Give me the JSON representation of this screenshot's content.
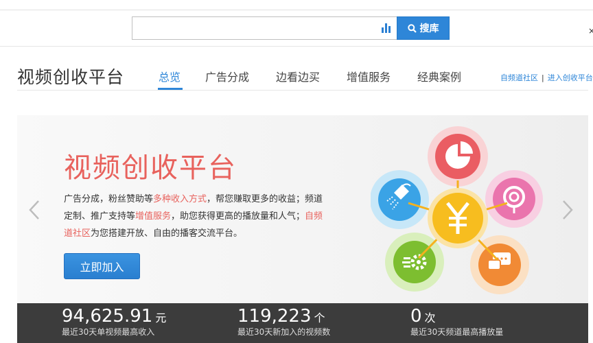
{
  "search": {
    "placeholder": "",
    "value": "",
    "button_label": "搜库"
  },
  "corner_mark": "×",
  "brand": {
    "title": "视频创收平台"
  },
  "nav": {
    "items": [
      {
        "label": "总览",
        "active": true
      },
      {
        "label": "广告分成",
        "active": false
      },
      {
        "label": "边看边买",
        "active": false
      },
      {
        "label": "增值服务",
        "active": false
      },
      {
        "label": "经典案例",
        "active": false
      }
    ],
    "links": [
      {
        "label": "自频道社区"
      },
      {
        "label": "进入创收平台"
      }
    ],
    "link_separator": "|"
  },
  "banner": {
    "title": "视频创收平台",
    "desc": {
      "p1": "广告分成，粉丝赞助等",
      "h1": "多种收入方式",
      "p2": "，帮您赚取更多的收益；频道定制、推广支持等",
      "h2": "增值服务",
      "p3": "，助您获得更高的播放量和人气；",
      "h3": "自频道社区",
      "p4": "为您搭建开放、自由的播客交流平台。"
    },
    "join_button": "立即加入",
    "icons": [
      "pie-chart-icon",
      "lollipop-icon",
      "chat-icon",
      "gear-icon",
      "watering-can-icon",
      "yuan-icon"
    ]
  },
  "stats": [
    {
      "value": "94,625.91",
      "unit": "元",
      "label": "最近30天单视频最高收入"
    },
    {
      "value": "119,223",
      "unit": "个",
      "label": "最近30天新加入的视频数"
    },
    {
      "value": "0",
      "unit": "次",
      "label": "最近30天频道最高播放量"
    }
  ],
  "colors": {
    "accent": "#2e86d8",
    "highlight": "#e8625d",
    "stats_bg": "#3c3c3c"
  }
}
